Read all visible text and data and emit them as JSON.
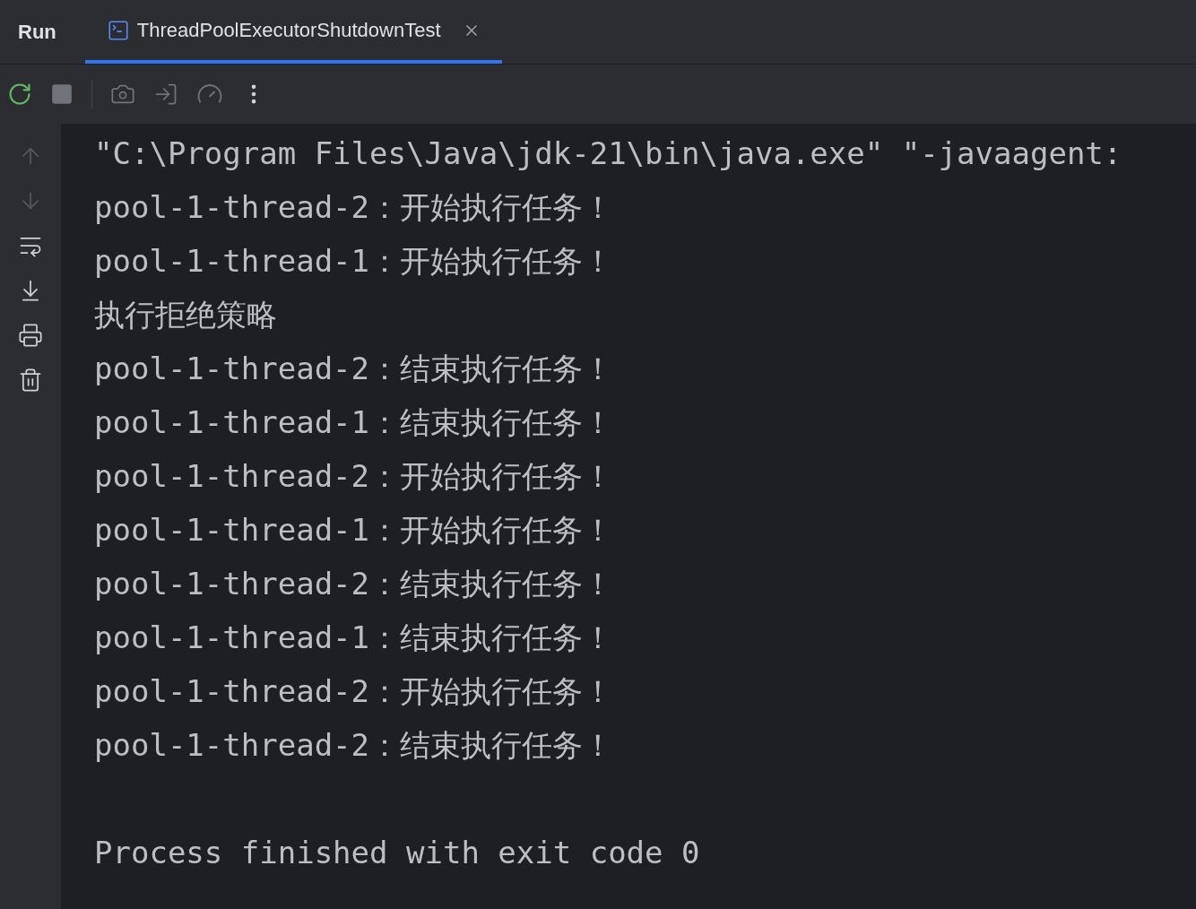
{
  "tool_window": {
    "title": "Run"
  },
  "tabs": [
    {
      "label": "ThreadPoolExecutorShutdownTest",
      "selected": true
    }
  ],
  "side_tools": [
    {
      "kind": "up",
      "disabled": true
    },
    {
      "kind": "down",
      "disabled": true
    },
    {
      "kind": "wrap",
      "disabled": false
    },
    {
      "kind": "scroll_end",
      "disabled": false
    },
    {
      "kind": "print",
      "disabled": false
    },
    {
      "kind": "clear",
      "disabled": false
    }
  ],
  "console": {
    "lines": [
      "\"C:\\Program Files\\Java\\jdk-21\\bin\\java.exe\" \"-javaagent:",
      "pool-1-thread-2：开始执行任务！",
      "pool-1-thread-1：开始执行任务！",
      "执行拒绝策略",
      "pool-1-thread-2：结束执行任务！",
      "pool-1-thread-1：结束执行任务！",
      "pool-1-thread-2：开始执行任务！",
      "pool-1-thread-1：开始执行任务！",
      "pool-1-thread-2：结束执行任务！",
      "pool-1-thread-1：结束执行任务！",
      "pool-1-thread-2：开始执行任务！",
      "pool-1-thread-2：结束执行任务！"
    ],
    "exit_message": "Process finished with exit code 0"
  }
}
